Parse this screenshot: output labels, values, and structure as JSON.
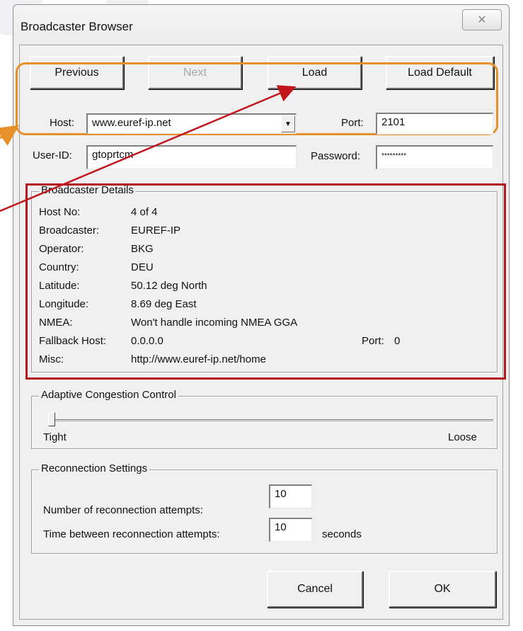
{
  "window": {
    "title": "Broadcaster Browser",
    "close_glyph": "✕"
  },
  "buttons": {
    "previous": "Previous",
    "next": "Next",
    "load": "Load",
    "load_default": "Load Default",
    "cancel": "Cancel",
    "ok": "OK"
  },
  "connection": {
    "host_label": "Host:",
    "host_value": "www.euref-ip.net",
    "port_label": "Port:",
    "port_value": "2101",
    "userid_label": "User-ID:",
    "userid_value": "gtoprtcm",
    "password_label": "Password:",
    "password_value": "*********"
  },
  "details": {
    "title": "Broadcaster Details",
    "rows": [
      {
        "key": "Host No:",
        "value": "4 of 4"
      },
      {
        "key": "Broadcaster:",
        "value": "EUREF-IP"
      },
      {
        "key": "Operator:",
        "value": "BKG"
      },
      {
        "key": "Country:",
        "value": "DEU"
      },
      {
        "key": "Latitude:",
        "value": "50.12 deg North"
      },
      {
        "key": "Longitude:",
        "value": "8.69 deg East"
      },
      {
        "key": "NMEA:",
        "value": "Won't handle incoming NMEA GGA"
      },
      {
        "key": "Fallback Host:",
        "value": "0.0.0.0"
      },
      {
        "key": "Misc:",
        "value": "http://www.euref-ip.net/home"
      }
    ],
    "fallback_port_label": "Port:",
    "fallback_port_value": "0"
  },
  "congestion": {
    "title": "Adaptive Congestion Control",
    "min_label": "Tight",
    "max_label": "Loose",
    "level": 0
  },
  "reconnection": {
    "title": "Reconnection Settings",
    "attempts_label": "Number of reconnection attempts:",
    "attempts_value": "10",
    "interval_label": "Time between reconnection attempts:",
    "interval_value": "10",
    "interval_unit": "seconds"
  },
  "annotations": {
    "orange": "#e8902a",
    "red": "#b3161c",
    "arrow": "#c0161c"
  }
}
